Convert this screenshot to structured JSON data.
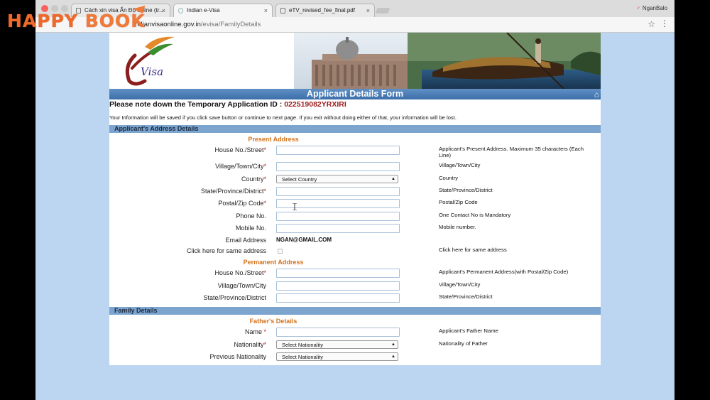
{
  "browser": {
    "tabs": [
      {
        "title": "Cách xin visa Ấn Độ online (tr...",
        "active": false
      },
      {
        "title": "Indian e-Visa",
        "active": true
      },
      {
        "title": "eTV_revised_fee_final.pdf",
        "active": false
      }
    ],
    "close_glyph": "×",
    "profile_name": "NganBalo",
    "url_host": "indianvisaonline.gov.in",
    "url_path": "/evisa/FamilyDetails"
  },
  "watermark": {
    "part1": "HAPPY ",
    "part2": "BOOK"
  },
  "page": {
    "logo_text": "Visa",
    "form_title": "Applicant Details Form",
    "temp_id_label": "Please note down the Temporary Application ID :",
    "temp_id_value": "022519082YRXIRI",
    "info_line": "Your Information will be saved if you click save button or continue to next page. If you exit without doing either of that, your information will be lost.",
    "address_section": {
      "title": "Applicant's Address Details",
      "present_heading": "Present Address",
      "present_rows": [
        {
          "label": "House No./Street",
          "required": true,
          "type": "text",
          "hint": "Applicant's Present Address. Maximum 35 characters (Each Line)"
        },
        {
          "label": "Village/Town/City",
          "required": true,
          "type": "text",
          "hint": "Village/Town/City"
        },
        {
          "label": "Country",
          "required": true,
          "type": "select",
          "value": "Select Country",
          "hint": "Country"
        },
        {
          "label": "State/Province/District",
          "required": true,
          "type": "text",
          "hint": "State/Province/District"
        },
        {
          "label": "Postal/Zip Code",
          "required": true,
          "type": "text",
          "hint": "Postal/Zip Code"
        },
        {
          "label": "Phone No.",
          "required": false,
          "type": "text",
          "hint": "One Contact No is Mandatory"
        },
        {
          "label": "Mobile No.",
          "required": false,
          "type": "text",
          "hint": "Mobile number."
        },
        {
          "label": "Email Address",
          "required": false,
          "type": "static",
          "value": "NGAN@GMAIL.COM",
          "hint": ""
        },
        {
          "label": "Click here for same address",
          "required": false,
          "type": "checkbox",
          "hint": "Click here for same address"
        }
      ],
      "permanent_heading": "Permanent Address",
      "permanent_rows": [
        {
          "label": "House No./Street",
          "required": true,
          "type": "text",
          "hint": "Applicant's Permanent Address(with Postal/Zip Code)"
        },
        {
          "label": "Village/Town/City",
          "required": false,
          "type": "text",
          "hint": "Village/Town/City"
        },
        {
          "label": "State/Province/District",
          "required": false,
          "type": "text",
          "hint": "State/Province/District"
        }
      ]
    },
    "family_section": {
      "title": "Family Details",
      "father_heading": "Father's Details",
      "rows": [
        {
          "label": "Name",
          "required": true,
          "type": "text",
          "hint": "Applicant's Father Name"
        },
        {
          "label": "Nationality",
          "required": true,
          "type": "select",
          "value": "Select Nationality",
          "hint": "Nationality of Father"
        },
        {
          "label": "Previous Nationality",
          "required": false,
          "type": "select",
          "value": "Select Nationality",
          "hint": ""
        }
      ]
    }
  }
}
